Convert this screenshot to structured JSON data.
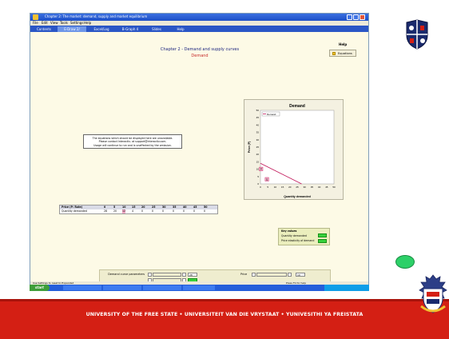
{
  "window": {
    "title": "Chapter 2: The market: demand, supply and market equilibrium",
    "menu": [
      "File",
      "Edit",
      "View",
      "Tools",
      "Settings",
      "Help"
    ],
    "tabs": [
      "Contents",
      "E-Draw 2/",
      "Excel/Log",
      "B-Graph 4",
      "Slides",
      "Help"
    ],
    "active_tab_index": 1
  },
  "content": {
    "title": "Chapter 2 - Demand and supply curves",
    "subtitle": "Demand",
    "help_label": "Help",
    "equations_button": "Equations",
    "message": [
      "The equations which should be displayed here are unavailable.",
      "Please contact Interactiv. at support@interactiv.com.",
      "Usage will continue to run and is unaffected by the omission."
    ],
    "table": {
      "price_label": "Price (P: Rate)",
      "price_values": [
        "0",
        "5",
        "10",
        "15",
        "20",
        "25",
        "30",
        "35",
        "40",
        "45",
        "50"
      ],
      "quantity_label": "Quantity demanded",
      "quantity_values": [
        "28",
        "20",
        "12",
        "4",
        "0",
        "0",
        "0",
        "0",
        "0",
        "0",
        "0"
      ]
    },
    "key_values": {
      "title": "Key values",
      "row1": "Quantity demanded",
      "row2": "Price elasticity of demand"
    },
    "controls": {
      "demand_label": "Demand curve parameters",
      "demand_value1": "28",
      "price_label": "Price",
      "price_value": "10"
    }
  },
  "chart_data": {
    "type": "line",
    "title": "Demand",
    "xlabel": "Quantity demanded",
    "ylabel": "Price (P)",
    "legend": "Demand",
    "legend_position": "top-left",
    "xlim": [
      0,
      50
    ],
    "ylim": [
      0,
      50
    ],
    "x_ticks": [
      "0",
      "5",
      "10",
      "15",
      "20",
      "25",
      "30",
      "35",
      "40",
      "45",
      "50"
    ],
    "y_ticks": [
      "0",
      "5",
      "10",
      "15",
      "20",
      "25",
      "30",
      "35",
      "40",
      "45",
      "50"
    ],
    "series": [
      {
        "name": "Demand",
        "x": [
          0,
          28
        ],
        "y": [
          14,
          0
        ],
        "color": "#c2185b"
      }
    ],
    "markers": [
      {
        "label": "P",
        "x": 0,
        "y": 10
      },
      {
        "label": "Q",
        "x": 4,
        "y": 3
      }
    ]
  },
  "status": {
    "left": "Use Settings to reset to Expanded",
    "right": "Press F1 for help"
  },
  "taskbar": {
    "start": "start",
    "items": [
      "",
      "",
      "",
      ""
    ],
    "clock": ""
  },
  "footer": {
    "text": "UNIVERSITY OF THE FREE STATE • UNIVERSITEIT VAN DIE VRYSTAAT • YUNIVESITHI YA FREISTATA"
  },
  "colors": {
    "footer_red": "#d41f14",
    "taskbar_blue": "#245edb",
    "start_green": "#3f9e3a",
    "key_value_green": "#38d13c",
    "demand_line": "#c2185b"
  },
  "icons": [
    "university-crest-icon",
    "university-seal-icon",
    "green-oval-icon",
    "equations-icon",
    "window-close-icon"
  ]
}
